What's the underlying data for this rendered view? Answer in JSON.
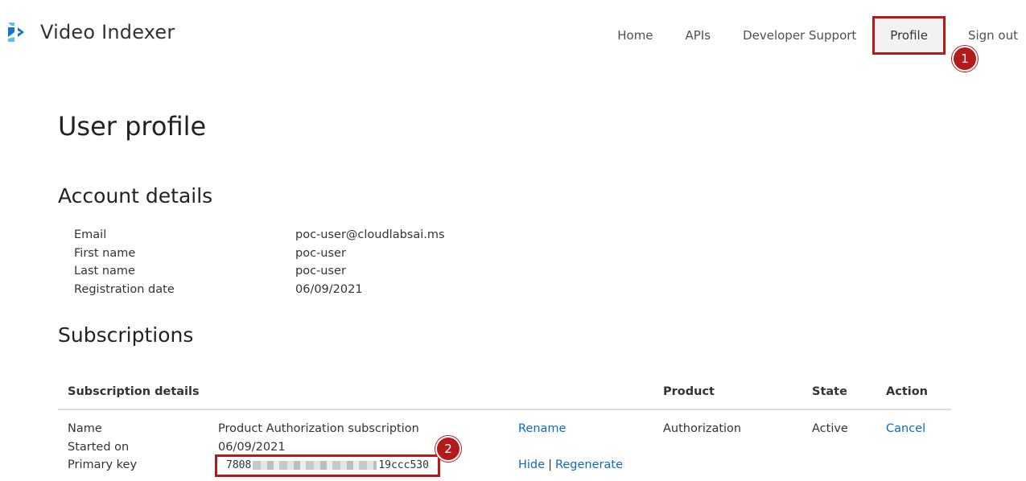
{
  "app": {
    "name": "Video Indexer"
  },
  "nav": {
    "items": [
      {
        "label": "Home"
      },
      {
        "label": "APIs"
      },
      {
        "label": "Developer Support"
      },
      {
        "label": "Profile",
        "active": true
      },
      {
        "label": "Sign out"
      }
    ]
  },
  "markers": {
    "one": "1",
    "two": "2"
  },
  "page": {
    "title": "User profile"
  },
  "account": {
    "heading": "Account details",
    "rows": [
      {
        "label": "Email",
        "value": "poc-user@cloudlabsai.ms"
      },
      {
        "label": "First name",
        "value": "poc-user"
      },
      {
        "label": "Last name",
        "value": "poc-user"
      },
      {
        "label": "Registration date",
        "value": "06/09/2021"
      }
    ]
  },
  "subscriptions": {
    "heading": "Subscriptions",
    "columns": {
      "details": "Subscription details",
      "product": "Product",
      "state": "State",
      "action": "Action"
    },
    "row": {
      "name_label": "Name",
      "name_value": "Product Authorization subscription",
      "rename": "Rename",
      "started_label": "Started on",
      "started_value": "06/09/2021",
      "key_label": "Primary key",
      "key_prefix": "7808",
      "key_suffix": "19ccc530",
      "hide": "Hide",
      "separator": "|",
      "regenerate": "Regenerate",
      "product": "Authorization",
      "state": "Active",
      "cancel": "Cancel"
    }
  },
  "colors": {
    "accent_link": "#0f6bbf",
    "highlight": "#b31b1b",
    "logo_light": "#5bc0eb",
    "logo_dark": "#1a73c9"
  }
}
